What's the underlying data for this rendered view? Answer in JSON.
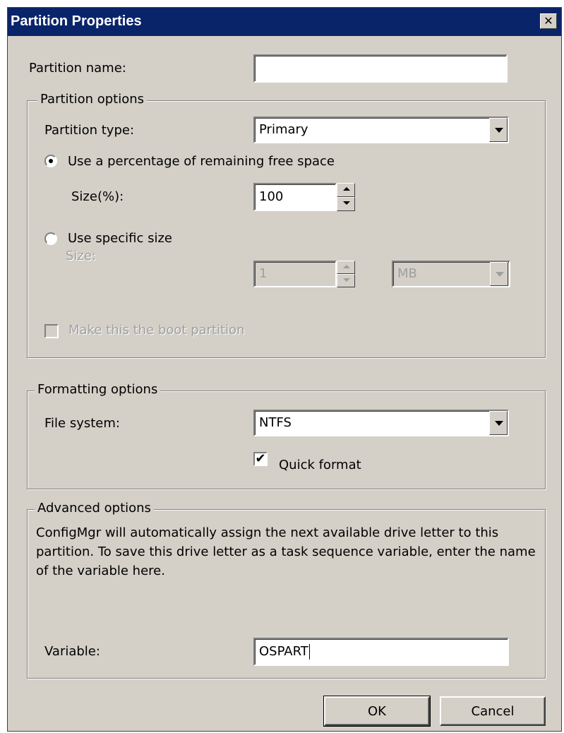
{
  "window": {
    "title": "Partition Properties",
    "close_label": "✕"
  },
  "partition_name": {
    "label": "Partition name:",
    "value": ""
  },
  "partition_options": {
    "title": "Partition options",
    "type_label": "Partition type:",
    "type_value": "Primary",
    "radio_percent_label": "Use a percentage of remaining free space",
    "size_percent_label": "Size(%):",
    "size_percent_value": "100",
    "radio_specific_label": "Use specific size",
    "size_label": "Size:",
    "size_value": "1",
    "unit_value": "MB",
    "boot_label": "Make this the boot partition"
  },
  "formatting_options": {
    "title": "Formatting options",
    "fs_label": "File system:",
    "fs_value": "NTFS",
    "quick_format_label": "Quick format",
    "quick_format_checked": true
  },
  "advanced_options": {
    "title": "Advanced options",
    "description": "ConfigMgr will automatically assign the next available drive letter to this partition. To save this drive letter as a task sequence variable, enter the name of the variable here.",
    "variable_label": "Variable:",
    "variable_value": "OSPART"
  },
  "buttons": {
    "ok": "OK",
    "cancel": "Cancel"
  },
  "icons": {
    "check": "✔"
  },
  "colors": {
    "titlebar": "#0a246a",
    "dialog_bg": "#d4d0c8"
  }
}
